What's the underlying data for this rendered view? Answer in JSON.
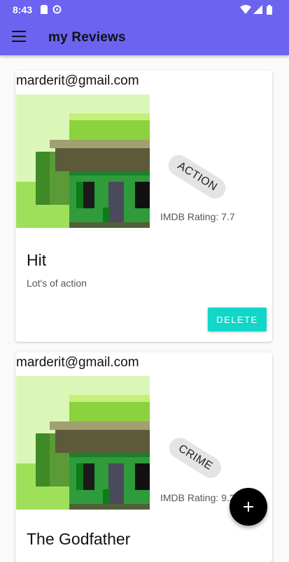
{
  "status_bar": {
    "time": "8:43",
    "icons": [
      "sd-card-icon",
      "sync-icon",
      "wifi-icon",
      "signal-icon",
      "battery-icon"
    ]
  },
  "app_bar": {
    "title": "my Reviews",
    "menu_icon": "menu-icon"
  },
  "reviews": [
    {
      "email": "marderit@gmail.com",
      "genre": "ACTION",
      "rating": "IMDB Rating: 7.7",
      "title": "Hit",
      "description": "Lot's of action",
      "delete_label": "DELETE"
    },
    {
      "email": "marderit@gmail.com",
      "genre": "CRIME",
      "rating": "IMDB Rating: 9.2",
      "title": "The Godfather"
    }
  ],
  "fab": {
    "icon": "plus-icon"
  },
  "colors": {
    "app_bar": "#6c63f0",
    "delete_button": "#11d6c8",
    "fab": "#000000"
  }
}
